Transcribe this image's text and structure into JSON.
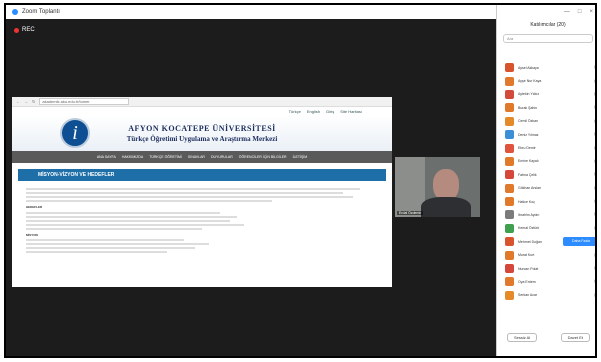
{
  "window": {
    "title": "Zoom Toplantı"
  },
  "recording": {
    "label": "REC"
  },
  "browser": {
    "url": "akademik.aku.edu.tr/tomer",
    "top_links": [
      "Türkçe",
      "English",
      "Giriş",
      "Site Haritası"
    ],
    "banner_title": "AFYON KOCATEPE ÜNİVERSİTESİ",
    "banner_subtitle": "Türkçe Öğretimi Uygulama ve Araştırma Merkezi",
    "logo_glyph": "i",
    "nav": [
      "ANA SAYFA",
      "HAKKIMIZDA",
      "TÜRKÇE ÖĞRETİMİ",
      "SINAVLAR",
      "DUYURULAR",
      "ÖĞRENCİLER İÇİN BİLGİLER",
      "İLETİŞİM"
    ],
    "section_title": "MİSYON-VİZYON VE HEDEFLER",
    "heading_goals": "HEDEFLER",
    "heading_mission": "MİSYON"
  },
  "speaker": {
    "name": "Erdal Özdemir"
  },
  "panel": {
    "title": "Katılımcılar (20)",
    "search_placeholder": "Ara",
    "window_controls": [
      "—",
      "□",
      "×"
    ],
    "more_button": "Daha Fazla",
    "mute_all": "Sessiz Al",
    "invite": "Davet Et",
    "participants": [
      {
        "name": "Aysel Akkaya",
        "color": "#d8542d"
      },
      {
        "name": "Ayşe Nur Kaya",
        "color": "#e0792c"
      },
      {
        "name": "Aytekin Yıldız",
        "color": "#d24a3a"
      },
      {
        "name": "Burak Şahin",
        "color": "#e07a2a"
      },
      {
        "name": "Cemil Özkan",
        "color": "#e58a28"
      },
      {
        "name": "Deniz Yılmaz",
        "color": "#3a8fd6"
      },
      {
        "name": "Ebru Demir",
        "color": "#e0533c"
      },
      {
        "name": "Emine Kayalı",
        "color": "#e07a2a"
      },
      {
        "name": "Fatma Çelik",
        "color": "#d6473b"
      },
      {
        "name": "Gökhan Arslan",
        "color": "#e0792c"
      },
      {
        "name": "Hatice Koç",
        "color": "#e07a2a"
      },
      {
        "name": "İbrahim Aydın",
        "color": "#7b7b7b"
      },
      {
        "name": "Kemal Öztürk",
        "color": "#3fa04f"
      },
      {
        "name": "Mehmet Doğan",
        "color": "#d8542d"
      },
      {
        "name": "Murat Kurt",
        "color": "#e07a2a"
      },
      {
        "name": "Nurcan Polat",
        "color": "#d6473b"
      },
      {
        "name": "Oya Erdem",
        "color": "#e0792c"
      },
      {
        "name": "Serkan Acar",
        "color": "#e58a28"
      }
    ]
  }
}
